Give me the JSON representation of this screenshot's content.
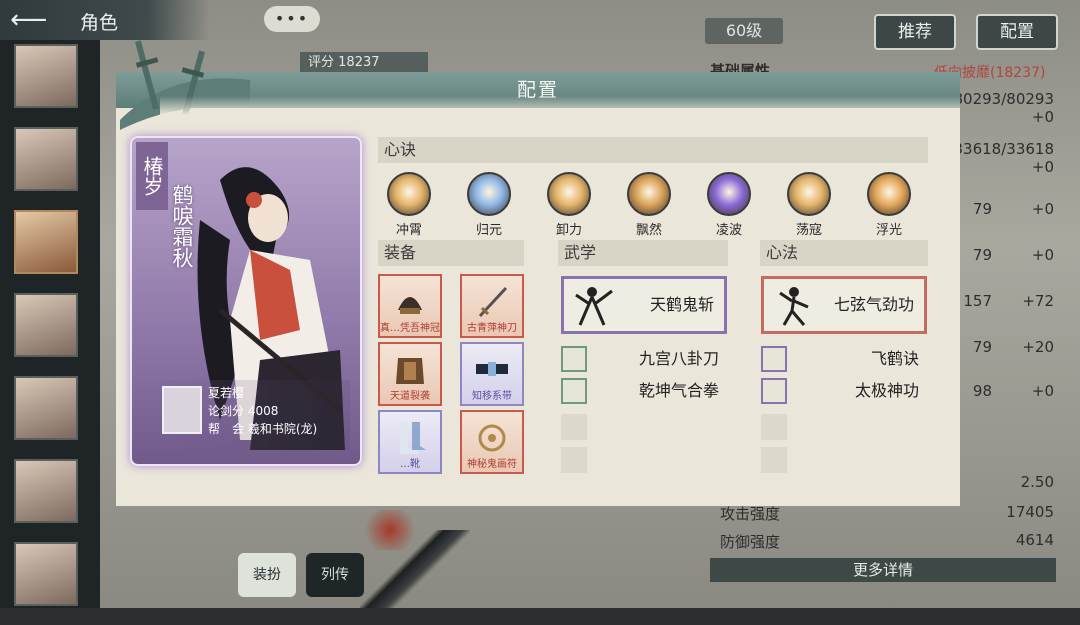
{
  "header": {
    "title": "角色",
    "back_icon": "arrow-left-icon",
    "chat_dots": "•••"
  },
  "top_right": {
    "level": "60级",
    "recommend_label": "推荐",
    "config_label": "配置"
  },
  "score": {
    "label": "评分",
    "value": "18237"
  },
  "background_panel": {
    "section": "基础属性",
    "link": "低向披靡(18237)",
    "rows": [
      {
        "k": "",
        "v": "80293/80293"
      },
      {
        "k": "",
        "v": "+0"
      },
      {
        "k": "",
        "v": "33618/33618"
      },
      {
        "k": "",
        "v": "+0"
      },
      {
        "k": "",
        "v": "79"
      },
      {
        "k": "",
        "v": "+0"
      },
      {
        "k": "",
        "v": "79"
      },
      {
        "k": "",
        "v": "+0"
      },
      {
        "k": "",
        "v": "157"
      },
      {
        "k": "",
        "v": "+72"
      },
      {
        "k": "",
        "v": "79"
      },
      {
        "k": "",
        "v": "+20"
      },
      {
        "k": "",
        "v": "98"
      },
      {
        "k": "",
        "v": "+0"
      },
      {
        "k": "",
        "v": "2.50"
      },
      {
        "k": "攻击强度",
        "v": "17405"
      },
      {
        "k": "防御强度",
        "v": "4614"
      }
    ],
    "more_label": "更多详情"
  },
  "bottom_tabs": {
    "equip": "装扮",
    "biography": "列传"
  },
  "modal": {
    "title": "配置",
    "character": {
      "flag": "椿岁",
      "name": "鹤唳霜秋",
      "player_name": "夏若樱",
      "score_line": "论剑分 4008",
      "guild_line": "帮　会 羲和书院(龙)"
    },
    "xinjue": {
      "title": "心诀",
      "skills": [
        {
          "label": "冲霄",
          "color": "#e3b36a"
        },
        {
          "label": "归元",
          "color": "#8fb6e8"
        },
        {
          "label": "卸力",
          "color": "#e3b36a"
        },
        {
          "label": "飘然",
          "color": "#d9a25a"
        },
        {
          "label": "凌波",
          "color": "#8b6bd8"
        },
        {
          "label": "荡寇",
          "color": "#e3b36a"
        },
        {
          "label": "浮光",
          "color": "#e3a75a"
        }
      ]
    },
    "equipment": {
      "title": "装备",
      "items": [
        {
          "name": "真…凭吾神冠",
          "tone": "red",
          "icon": "helmet-icon"
        },
        {
          "name": "古青萍神刀",
          "tone": "red",
          "icon": "sword-icon"
        },
        {
          "name": "天道裂袭",
          "tone": "red",
          "icon": "armor-icon"
        },
        {
          "name": "知移系带",
          "tone": "blue",
          "icon": "belt-icon"
        },
        {
          "name": "…靴",
          "tone": "blue",
          "icon": "boots-icon"
        },
        {
          "name": "神秘鬼画符",
          "tone": "red",
          "icon": "talisman-icon"
        }
      ]
    },
    "wuxue": {
      "title": "武学",
      "main": "天鹤鬼斩",
      "subs": [
        "九宫八卦刀",
        "乾坤气合拳"
      ]
    },
    "xinfa": {
      "title": "心法",
      "main": "七弦气劲功",
      "subs": [
        "飞鹤诀",
        "太极神功"
      ]
    }
  },
  "colors": {
    "modal_header": "#6d8c87",
    "modal_body": "#eae6da",
    "card_glow": "#b08cd2",
    "accent_red": "#c95a4a",
    "accent_purple": "#8a72ae"
  }
}
